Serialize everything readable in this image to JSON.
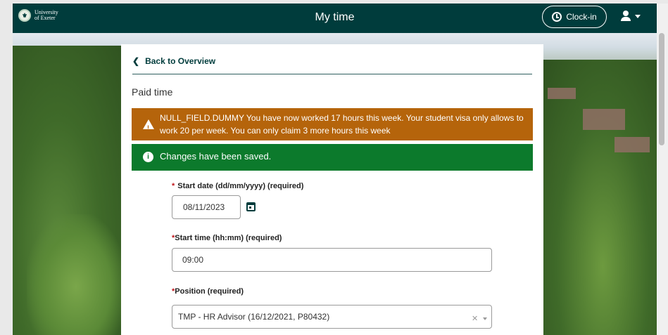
{
  "header": {
    "logo_line1": "University",
    "logo_line2": "of Exeter",
    "title": "My time",
    "clockin_label": "Clock-in"
  },
  "card": {
    "back_label": "Back to Overview",
    "section_title": "Paid time",
    "warning_text": "NULL_FIELD.DUMMY You have now worked 17 hours this week. Your student visa only allows to work 20 per week. You can only claim 3 more hours this week",
    "success_text": "Changes have been saved.",
    "start_date": {
      "label": "Start date (dd/mm/yyyy) (required)",
      "value": "08/11/2023"
    },
    "start_time": {
      "label": "Start time (hh:mm) (required)",
      "value": "09:00"
    },
    "position": {
      "label": "Position  (required)",
      "value": "TMP - HR Advisor (16/12/2021, P80432)"
    },
    "required_marker": "*"
  },
  "colors": {
    "header_bg": "#003c3c",
    "warning_bg": "#b5640b",
    "success_bg": "#0c7a2c",
    "required": "#c0171c"
  }
}
